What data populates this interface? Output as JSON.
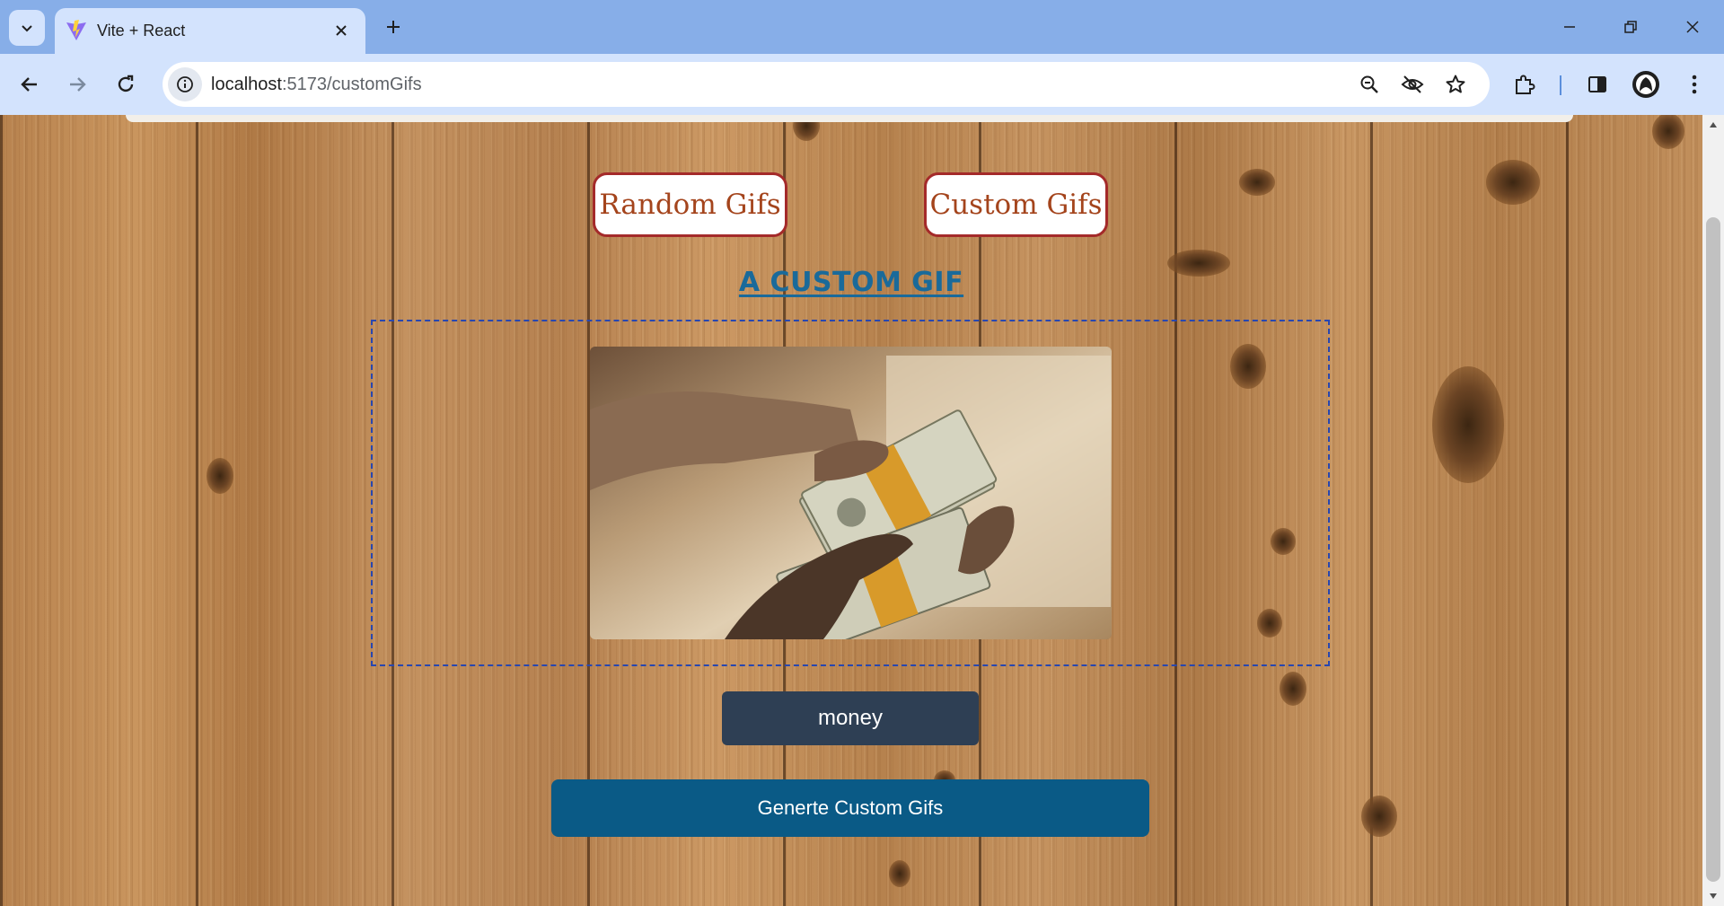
{
  "browser": {
    "tab_title": "Vite + React",
    "url_host": "localhost",
    "url_path": ":5173/customGifs",
    "icons": {
      "tab_search": "chevron-down-icon",
      "favicon": "vite-logo-icon",
      "tab_close": "close-icon",
      "new_tab": "plus-icon",
      "minimize": "minimize-icon",
      "restore": "restore-icon",
      "close_window": "close-icon",
      "back": "arrow-left-icon",
      "forward": "arrow-right-icon",
      "reload": "reload-icon",
      "site_info": "info-icon",
      "zoom": "zoom-out-icon",
      "tracking": "eye-off-icon",
      "bookmark": "star-icon",
      "extensions": "puzzle-icon",
      "side_panel": "side-panel-icon",
      "profile": "avatar-icon",
      "menu": "more-vert-icon"
    }
  },
  "page": {
    "nav": {
      "random_label": "Random Gifs",
      "custom_label": "Custom Gifs"
    },
    "heading": "A CUSTOM GIF",
    "search_value": "money",
    "generate_label": "Generte Custom Gifs",
    "colors": {
      "nav_border": "#a42a2a",
      "nav_text": "#a4441c",
      "heading": "#1a6a9a",
      "input_bg": "#2e3f54",
      "button_bg": "#0a5a86",
      "box_border": "#2847b0"
    }
  }
}
